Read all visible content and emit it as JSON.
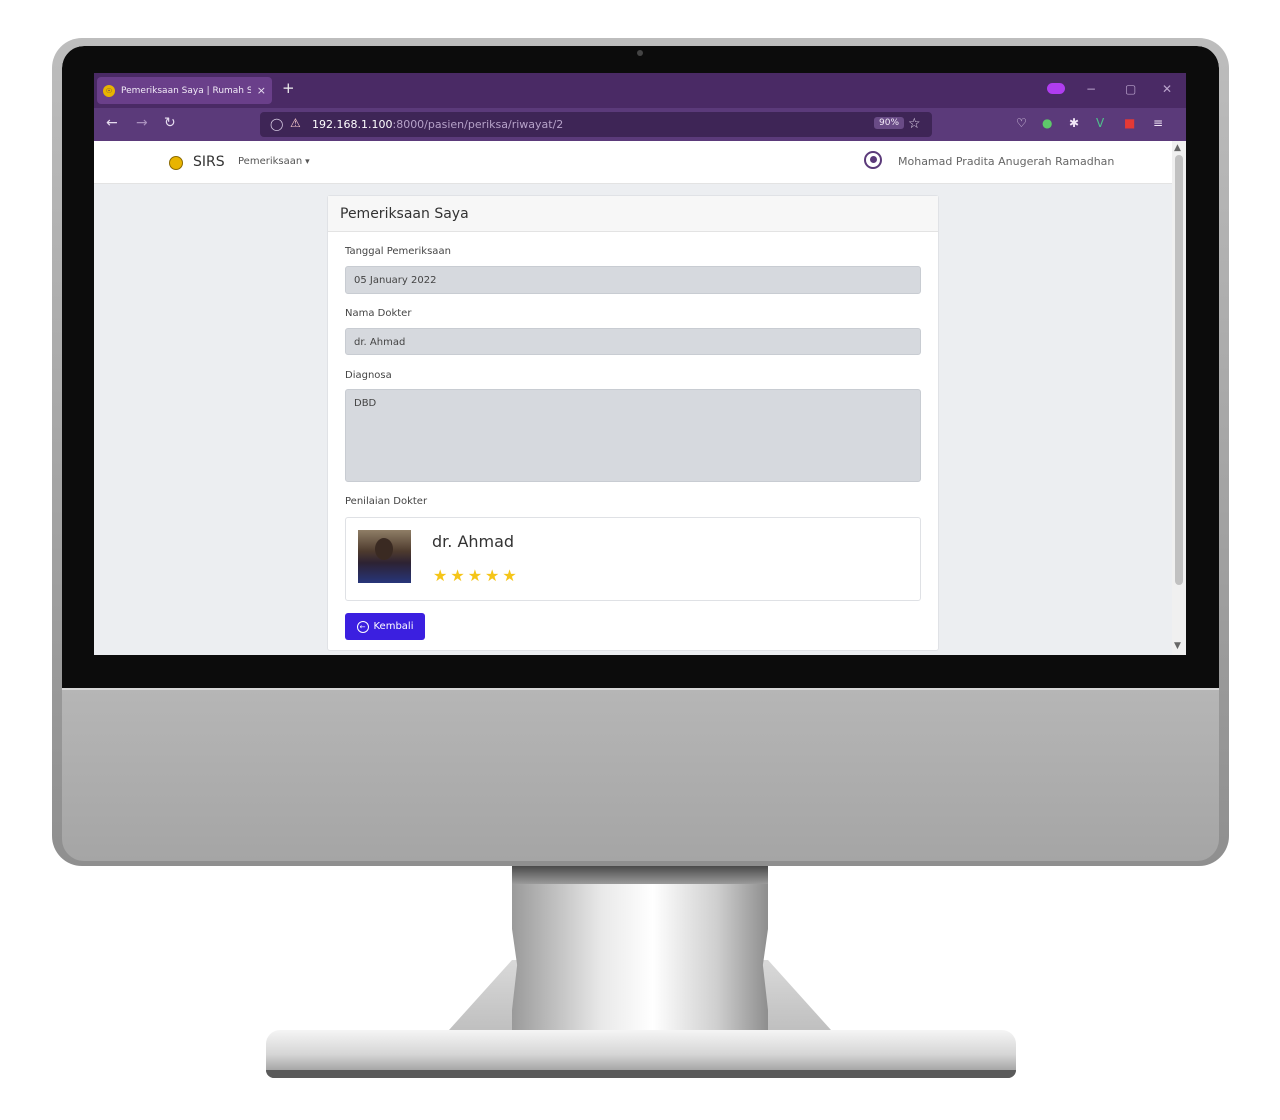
{
  "browser": {
    "tab_title": "Pemeriksaan Saya | Rumah Saki",
    "tab_close": "×",
    "new_tab": "+",
    "url_host": "192.168.1.100",
    "url_path": ":8000/pasien/periksa/riwayat/2",
    "zoom": "90%",
    "window_controls": [
      "−",
      "▢",
      "✕"
    ]
  },
  "site": {
    "brand": "SIRS",
    "menu": "Pemeriksaan",
    "user": "Mohamad Pradita Anugerah Ramadhan"
  },
  "card": {
    "title": "Pemeriksaan Saya",
    "tanggal_label": "Tanggal Pemeriksaan",
    "tanggal_value": "05 January 2022",
    "dokter_label": "Nama Dokter",
    "dokter_value": "dr. Ahmad",
    "diagnosa_label": "Diagnosa",
    "diagnosa_value": "DBD",
    "penilaian_label": "Penilaian Dokter",
    "rating_name": "dr. Ahmad",
    "rating": 5,
    "back_label": "Kembali"
  },
  "colors": {
    "tabbar": "#4a2a65",
    "navbar": "#5b3a7a",
    "button": "#3b1fe0",
    "star": "#f5c518"
  }
}
